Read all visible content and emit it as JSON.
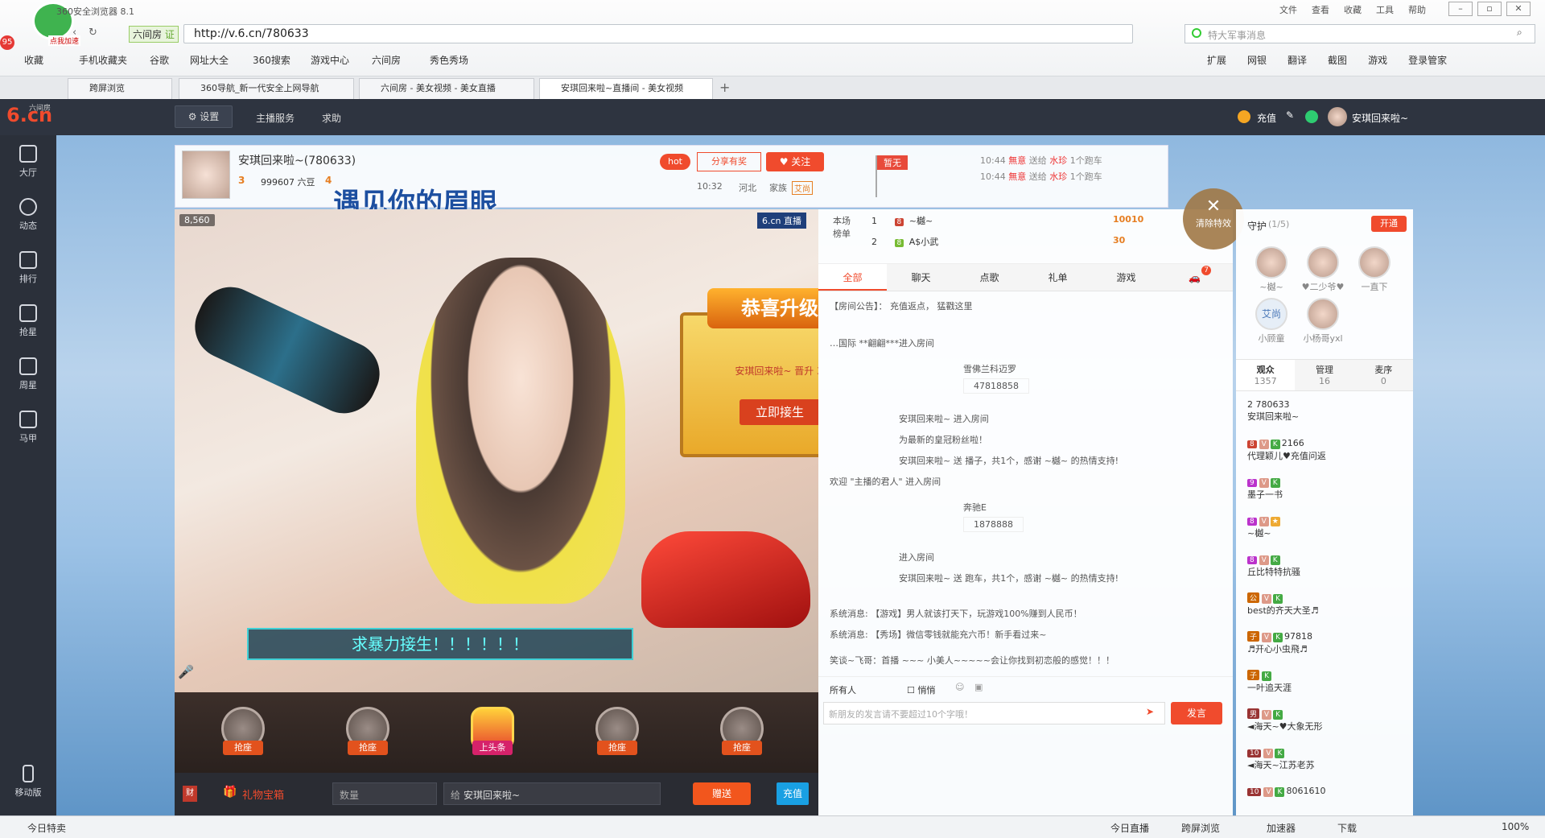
{
  "browser": {
    "title": "360安全浏览器 8.1",
    "menu": [
      "文件",
      "查看",
      "收藏",
      "工具",
      "帮助"
    ],
    "badge_count": "95",
    "speedup_label": "点我加速",
    "site_label": "六间房",
    "cert_label": "证",
    "url": "http://v.6.cn/780633",
    "search_placeholder": "特大军事消息",
    "bookmarks": [
      "收藏",
      "手机收藏夹",
      "谷歌",
      "网址大全",
      "360搜索",
      "游戏中心",
      "六间房",
      "秀色秀场"
    ],
    "right_tools": [
      "扩展",
      "网银",
      "翻译",
      "截图",
      "游戏",
      "登录管家"
    ],
    "tabs": [
      "跨屏浏览",
      "360导航_新一代安全上网导航",
      "六间房 - 美女视频 - 美女直播",
      "安琪回来啦~直播间 - 美女视频"
    ]
  },
  "site": {
    "logo_text": "6.cn",
    "logo_sub": "六间房",
    "settings_label": "设置",
    "anchor_service": "主播服务",
    "help": "求助",
    "recharge": "充值",
    "user_name": "安琪回来啦~"
  },
  "sidebar": [
    {
      "label": "大厅",
      "icon": "tv-icon"
    },
    {
      "label": "动态",
      "icon": "compass-icon"
    },
    {
      "label": "排行",
      "icon": "crown-icon"
    },
    {
      "label": "抢星",
      "icon": "star-icon"
    },
    {
      "label": "周星",
      "icon": "trophy-icon"
    },
    {
      "label": "马甲",
      "icon": "vest-icon"
    }
  ],
  "sidebar_mobile": "移动版",
  "room": {
    "title": "安琪回来啦~(780633)",
    "level": "3",
    "beans": "999607 六豆",
    "level_next": "4",
    "hot": "hot",
    "share": "分享有奖",
    "follow": "关注",
    "time": "10:32",
    "location": "河北",
    "family_label": "家族",
    "family_tag": "艾尚",
    "banner": "遇见你的眉眼",
    "flag_label": "暂无",
    "gift_feed": [
      {
        "time": "10:44",
        "from": "無意",
        "verb": "送给",
        "to": "水珍",
        "item": "1个跑车"
      },
      {
        "time": "10:44",
        "from": "無意",
        "verb": "送给",
        "to": "水珍",
        "item": "1个跑车"
      }
    ],
    "clear_effects": "清除特效",
    "wealth": "8,560",
    "brand": "6.cn 直播"
  },
  "upgrade": {
    "title": "恭喜升级",
    "text": "安琪回来啦~ 晋升 3",
    "button": "立即接生"
  },
  "video_caption": "求暴力接生！！！！！！",
  "slots": [
    "抢座",
    "抢座",
    "上头条",
    "抢座",
    "抢座"
  ],
  "gift_bar": {
    "wealth_icon": "财",
    "gift_box": "礼物宝箱",
    "quantity_placeholder": "数量",
    "to_label": "给",
    "to_name": "安琪回来啦~",
    "send": "赠送",
    "recharge": "充值"
  },
  "rank": {
    "label": "本场榜单",
    "rows": [
      {
        "pos": "1",
        "name": "~樾~",
        "value": "10010"
      },
      {
        "pos": "2",
        "name": "A$小武",
        "value": "30"
      }
    ]
  },
  "chat_tabs": [
    "全部",
    "聊天",
    "点歌",
    "礼单",
    "游戏"
  ],
  "chat_badge": "7",
  "chat_lines": [
    {
      "text": "【房间公告】： 充值返点， 猛戳这里",
      "cls": "ann"
    },
    {
      "text": "…国际 **翩翩***进入房间",
      "cls": ""
    },
    {
      "text": "雪佛兰科迈罗",
      "cls": ""
    },
    {
      "text": "47818858",
      "cls": "ann"
    },
    {
      "text": "安琪回来啦~ 进入房间",
      "cls": ""
    },
    {
      "text": "为最新的皇冠粉丝啦！",
      "cls": "ann"
    },
    {
      "text": "安琪回来啦~ 送 播子，共1个，感谢 ~樾~ 的热情支持!",
      "cls": ""
    },
    {
      "text": "欢迎 \"主播的君人\" 进入房间",
      "cls": ""
    },
    {
      "text": "奔驰E",
      "cls": ""
    },
    {
      "text": "1878888",
      "cls": "ann"
    },
    {
      "text": "进入房间",
      "cls": ""
    },
    {
      "text": "安琪回来啦~ 送 跑车，共1个，感谢 ~樾~ 的热情支持!",
      "cls": ""
    },
    {
      "text": "系统消息: 【游戏】男人就该打天下，玩游戏100%赚到人民币！",
      "cls": "ann"
    },
    {
      "text": "系统消息: 【秀场】微信零钱就能充六币！新手看过来~",
      "cls": "ann"
    },
    {
      "text": "笑谈~飞哥：首播 ~~~ 小美人~~~~~会让你找到初恋般的感觉！！！",
      "cls": ""
    }
  ],
  "chat_input": {
    "target": "所有人",
    "private": "悄悄",
    "placeholder": "新朋友的发言请不要超过10个字哦！",
    "send": "发言"
  },
  "guard": {
    "title": "守护",
    "count": "(1/5)",
    "open": "开通",
    "members": [
      "~樾~",
      "♥二少爷♥",
      "一直下",
      "小顾童",
      "小杨哥yxl"
    ],
    "member_tag": "艾尚"
  },
  "audience_tabs": [
    {
      "label": "观众",
      "count": "1357"
    },
    {
      "label": "管理",
      "count": "16"
    },
    {
      "label": "麦序",
      "count": "0"
    }
  ],
  "audience": [
    {
      "line1": "2 780633",
      "line2": "安琪回来啦~"
    },
    {
      "line1": "2166",
      "line2": "代理颖儿♥充值问返"
    },
    {
      "line1": "",
      "line2": "墨子一书"
    },
    {
      "line1": "",
      "line2": "~樾~"
    },
    {
      "line1": "",
      "line2": "丘比特特抗骚"
    },
    {
      "line1": "",
      "line2": "best的齐天大圣♬"
    },
    {
      "line1": "97818",
      "line2": "♬开心小虫飛♬"
    },
    {
      "line1": "",
      "line2": "一叶追天涯"
    },
    {
      "line1": "",
      "line2": "◄海天~♥大象无形"
    },
    {
      "line1": "",
      "line2": "◄海天~江苏老苏"
    },
    {
      "line1": "8061610",
      "line2": ""
    }
  ],
  "status_bar": {
    "left": "今日特卖",
    "items": [
      "今日直播",
      "跨屏浏览",
      "加速器",
      "下载"
    ],
    "zoom": "100%"
  }
}
